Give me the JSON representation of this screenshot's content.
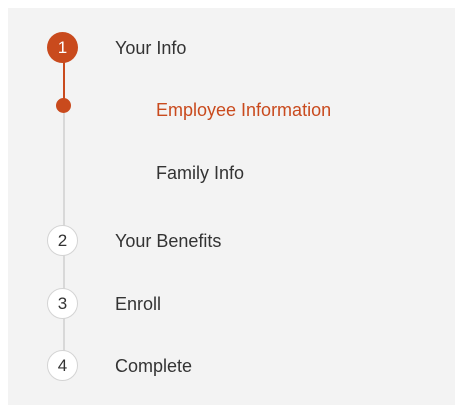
{
  "accent_color": "#c94a1d",
  "steps": [
    {
      "number": "1",
      "label": "Your Info",
      "state": "active",
      "substeps": [
        {
          "label": "Employee Information",
          "state": "current"
        },
        {
          "label": "Family Info",
          "state": "pending"
        }
      ]
    },
    {
      "number": "2",
      "label": "Your Benefits",
      "state": "pending"
    },
    {
      "number": "3",
      "label": "Enroll",
      "state": "pending"
    },
    {
      "number": "4",
      "label": "Complete",
      "state": "pending"
    }
  ]
}
